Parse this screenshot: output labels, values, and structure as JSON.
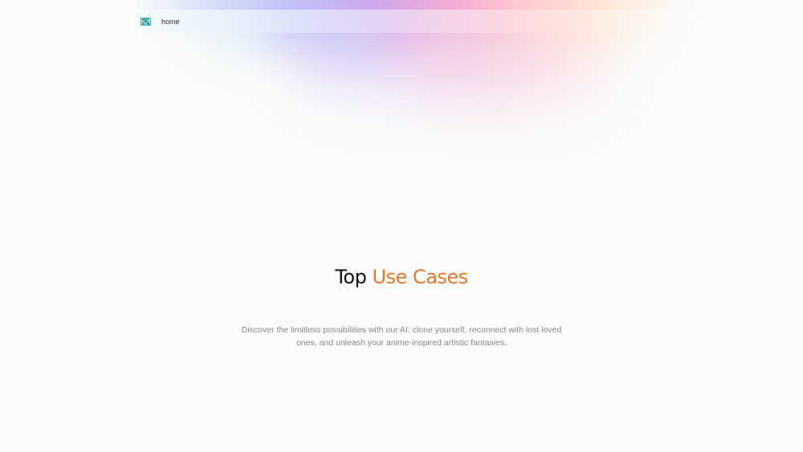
{
  "header": {
    "logo_icon": "brand-logo-icon",
    "nav": [
      {
        "label": "home"
      }
    ]
  },
  "hero": {
    "title_prefix": "Top",
    "title_accent": "Use Cases",
    "subtitle": "Discover the limitless possibilities with our AI: clone yourself, reconnect with lost loved ones, and unleash your anime-inspired artistic fantasies."
  },
  "colors": {
    "accent": "#e8772b",
    "logo": "#3fb0b8",
    "background": "#fbfbfb"
  }
}
